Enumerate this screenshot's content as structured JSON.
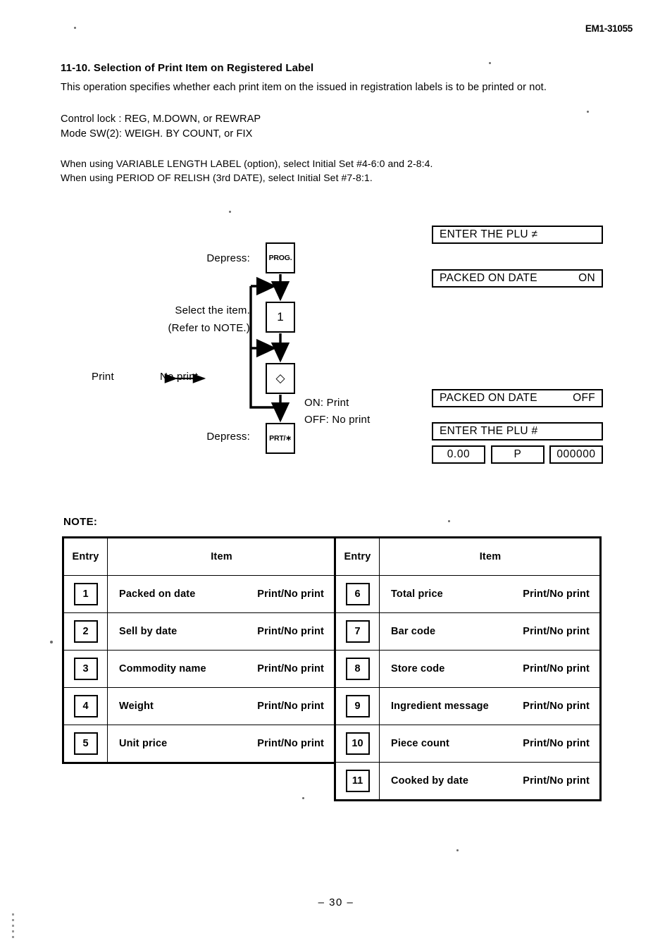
{
  "header": {
    "doc_code": "EM1-31055"
  },
  "section": {
    "title": "11-10. Selection of Print Item on Registered Label",
    "intro": "This operation specifies whether each print item on the issued in registration labels is to be printed or not.",
    "control_lock": "Control lock : REG, M.DOWN, or REWRAP\nMode SW(2): WEIGH. BY COUNT, or FIX",
    "options": "When using VARIABLE LENGTH LABEL (option), select Initial Set #4-6:0 and 2-8:4.\nWhen using PERIOD OF RELISH (3rd DATE), select Initial Set #7-8:1."
  },
  "flow": {
    "label_depress_1": "Depress:",
    "label_select": "Select the item.\n(Refer to NOTE.)",
    "label_print_toggle": "Print ⟷ No print",
    "label_depress_2": "Depress:",
    "legend": "ON:  Print\nOFF:  No print",
    "keys": {
      "prog": "PROG.",
      "one": "1",
      "diamond": "◇",
      "print": "PRT/∗"
    }
  },
  "displays": {
    "plu_prompt_1": "ENTER THE PLU  ≠",
    "packed_on_date_label_1": "PACKED ON DATE",
    "packed_on_date_value_1": "ON",
    "packed_on_date_label_2": "PACKED ON DATE",
    "packed_on_date_value_2": "OFF",
    "plu_prompt_2": "ENTER THE PLU  #",
    "segment_weight": "0.00",
    "segment_mode": "P",
    "segment_plu": "000000"
  },
  "note": {
    "label": "NOTE:",
    "headers": {
      "entry": "Entry",
      "item": "Item"
    },
    "left_rows": [
      {
        "entry": "1",
        "item": "Packed on date",
        "value": "Print/No print"
      },
      {
        "entry": "2",
        "item": "Sell by date",
        "value": "Print/No print"
      },
      {
        "entry": "3",
        "item": "Commodity name",
        "value": "Print/No print"
      },
      {
        "entry": "4",
        "item": "Weight",
        "value": "Print/No print"
      },
      {
        "entry": "5",
        "item": "Unit price",
        "value": "Print/No print"
      }
    ],
    "right_rows": [
      {
        "entry": "6",
        "item": "Total price",
        "value": "Print/No print"
      },
      {
        "entry": "7",
        "item": "Bar code",
        "value": "Print/No print"
      },
      {
        "entry": "8",
        "item": "Store code",
        "value": "Print/No print"
      },
      {
        "entry": "9",
        "item": "Ingredient message",
        "value": "Print/No print"
      },
      {
        "entry": "10",
        "item": "Piece count",
        "value": "Print/No print"
      },
      {
        "entry": "11",
        "item": "Cooked by date",
        "value": "Print/No print"
      }
    ]
  },
  "footer": {
    "page_number": "– 30 –"
  }
}
